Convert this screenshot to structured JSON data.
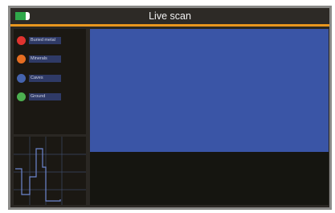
{
  "header": {
    "title": "Live scan",
    "battery_icon": "battery-icon"
  },
  "legend": {
    "items": [
      {
        "label": "Buried metal",
        "color": "#e0332f"
      },
      {
        "label": "Minerals",
        "color": "#e56d22"
      },
      {
        "label": "Caves",
        "color": "#4563ad"
      },
      {
        "label": "Ground",
        "color": "#4caf50"
      }
    ]
  },
  "colors": {
    "accent": "#e8961e",
    "scan_area": "#3a55a6",
    "panel_bg": "#1b1813"
  }
}
